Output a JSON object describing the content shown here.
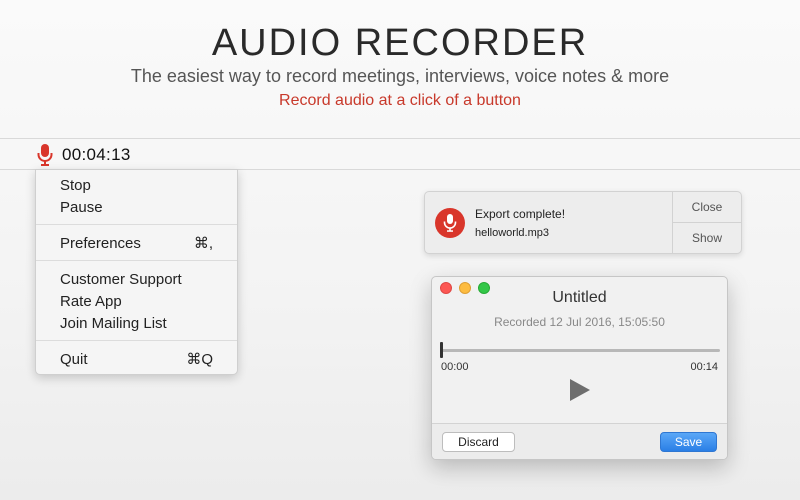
{
  "hero": {
    "title": "AUDIO RECORDER",
    "subtitle": "The easiest way to record meetings, interviews, voice notes & more",
    "tagline": "Record audio at a click of a button"
  },
  "menubar": {
    "icon": "microphone-icon",
    "timer": "00:04:13",
    "accent_color": "#d9362b"
  },
  "menu": {
    "groups": [
      [
        {
          "label": "Stop",
          "shortcut": ""
        },
        {
          "label": "Pause",
          "shortcut": ""
        }
      ],
      [
        {
          "label": "Preferences",
          "shortcut": "⌘,"
        }
      ],
      [
        {
          "label": "Customer Support",
          "shortcut": ""
        },
        {
          "label": "Rate App",
          "shortcut": ""
        },
        {
          "label": "Join Mailing List",
          "shortcut": ""
        }
      ],
      [
        {
          "label": "Quit",
          "shortcut": "⌘Q"
        }
      ]
    ]
  },
  "notification": {
    "icon": "microphone-icon",
    "title": "Export complete!",
    "filename": "helloworld.mp3",
    "close_label": "Close",
    "show_label": "Show"
  },
  "window": {
    "title": "Untitled",
    "recorded": "Recorded 12 Jul 2016, 15:05:50",
    "current_time": "00:00",
    "duration": "00:14",
    "progress": 0,
    "discard_label": "Discard",
    "save_label": "Save",
    "save_color": "#2a7fe6"
  }
}
